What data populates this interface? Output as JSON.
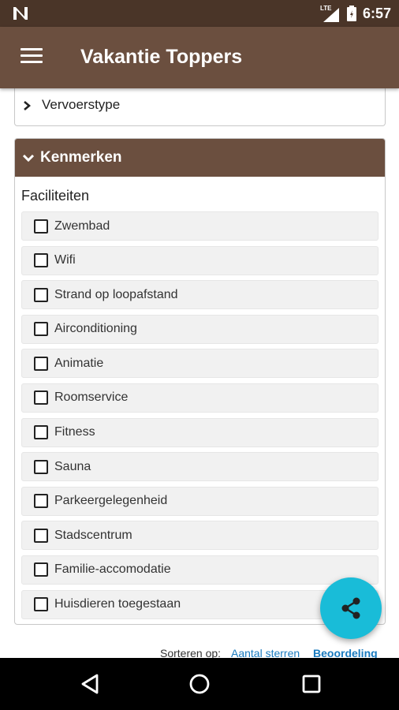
{
  "status_bar": {
    "time": "6:57",
    "network": "LTE"
  },
  "app_bar": {
    "title": "Vakantie Toppers",
    "menu_icon": "hamburger-menu-icon"
  },
  "filters": {
    "collapsed_section": {
      "label": "Vervoerstype",
      "icon": "chevron-right-icon"
    },
    "expanded_section": {
      "label": "Kenmerken",
      "icon": "chevron-down-icon",
      "group_label": "Faciliteiten",
      "items": [
        {
          "label": "Zwembad",
          "checked": false
        },
        {
          "label": "Wifi",
          "checked": false
        },
        {
          "label": "Strand op loopafstand",
          "checked": false
        },
        {
          "label": "Airconditioning",
          "checked": false
        },
        {
          "label": "Animatie",
          "checked": false
        },
        {
          "label": "Roomservice",
          "checked": false
        },
        {
          "label": "Fitness",
          "checked": false
        },
        {
          "label": "Sauna",
          "checked": false
        },
        {
          "label": "Parkeergelegenheid",
          "checked": false
        },
        {
          "label": "Stadscentrum",
          "checked": false
        },
        {
          "label": "Familie-accomodatie",
          "checked": false
        },
        {
          "label": "Huisdieren toegestaan",
          "checked": false
        }
      ]
    }
  },
  "sort": {
    "label": "Sorteren op:",
    "options": [
      "Aantal sterren",
      "Beoordeling"
    ]
  },
  "fab": {
    "icon": "share-icon"
  },
  "nav_bar": {
    "back_icon": "back-triangle-icon",
    "home_icon": "home-circle-icon",
    "recents_icon": "recents-square-icon"
  },
  "colors": {
    "status_bar": "#4a3528",
    "app_bar": "#6b4f3f",
    "fab": "#19bcd8",
    "link": "#1a7bbf"
  }
}
